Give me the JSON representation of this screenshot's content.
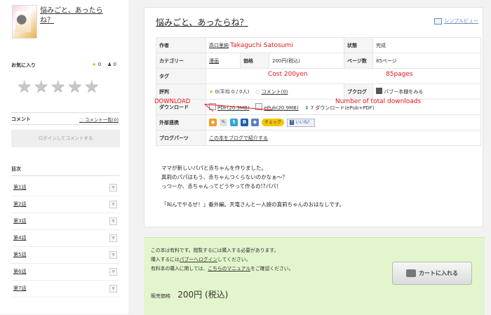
{
  "sidebar": {
    "title": "悩みごと、あったらね？",
    "favorites_label": "お気に入り",
    "fav_star_count": "0",
    "fav_user_count": "0",
    "comment_label": "コメント",
    "comment_list_link": "コメント一覧(0)",
    "login_to_comment": "ログインしてコメントする",
    "toc_label": "目次",
    "chapters": [
      "第1話",
      "第2話",
      "第3話",
      "第4話",
      "第5話",
      "第6話",
      "第7話"
    ]
  },
  "main": {
    "title": "悩みごと、あったらね？",
    "simple_view": "シンプルビュー",
    "labels": {
      "author": "作者",
      "status": "状態",
      "category": "カテゴリー",
      "price": "価格",
      "pages": "ページ数",
      "tag": "タグ",
      "rating": "評判",
      "bookmark": "ブクログ",
      "download": "ダウンロード",
      "external": "外部連携",
      "blog_parts": "ブログパーツ"
    },
    "values": {
      "author": "高口里純",
      "status": "完成",
      "category": "漫画",
      "price": "200円(税込)",
      "pages": "85ページ",
      "rating": "0(平均 0 / 0人)",
      "comments": "コメント(0)",
      "bookmark_btn": "パブー本棚をみる",
      "pdf": "PDF(20.3MB)",
      "epub": "ePub(20.9MB)",
      "dl_count": "7 ダウンロード(ePub+PDF)",
      "check": "チェック",
      "like": "いいね！",
      "blog_link": "この本をブログで紹介する"
    },
    "annotations": {
      "author": "Takaguchi Satosumi",
      "cost": "Cost 200yen",
      "pages": "85pages",
      "download": "DOWNLOAD",
      "downloads_count": "Number of total downloads"
    },
    "description": [
      "ママが新しいパパと赤ちゃんを作りました。",
      "真莉のパパはもう、赤ちゃんつくらないのかなぁ～？",
      "っつーか、赤ちゃんってどうやって作るの!?パパ！",
      "",
      "「叫んでやるぜ！」番外編。天竜さんと一人娘の真莉ちゃんのおはなしです。"
    ]
  },
  "purchase": {
    "line1": "この本は有料です。閲覧するには購入する必要があります。",
    "line2_pre": "購入するには",
    "line2_link": "パブーへログイン",
    "line2_post": "してください。",
    "line3_pre": "有料本の購入に関しては、",
    "line3_link": "こちらのマニュアル",
    "line3_post": "をご確認ください。",
    "price_label": "販売価格",
    "price_value": "200円 (税込)",
    "cart_button": "カートに入れる"
  }
}
